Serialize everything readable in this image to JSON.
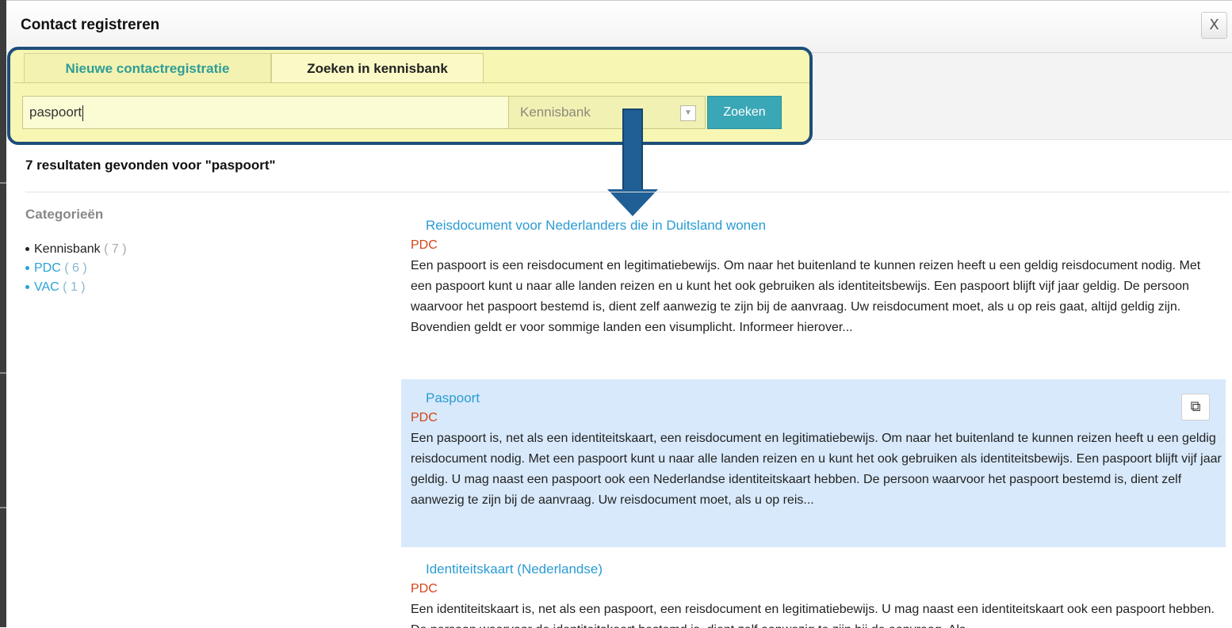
{
  "dialog": {
    "title": "Contact registreren",
    "close_label": "X"
  },
  "tabs": [
    {
      "label": "Nieuwe contactregistratie",
      "active": false
    },
    {
      "label": "Zoeken in kennisbank",
      "active": true
    }
  ],
  "search": {
    "query": "paspoort",
    "source_select": "Kennisbank",
    "button_label": "Zoeken"
  },
  "results_header": "7 resultaten gevonden voor \"paspoort\"",
  "categories": {
    "title": "Categorieën",
    "items": [
      {
        "label": "Kennisbank",
        "count": "( 7 )"
      },
      {
        "label": "PDC",
        "count": "( 6 )"
      },
      {
        "label": "VAC",
        "count": "( 1 )"
      }
    ]
  },
  "results": [
    {
      "title": "Reisdocument voor Nederlanders die in Duitsland wonen",
      "source": "PDC",
      "snippet": "Een paspoort is een reisdocument en legitimatiebewijs. Om naar het buitenland te kunnen reizen heeft u een geldig reisdocument nodig. Met een paspoort kunt u naar alle landen reizen en u kunt het ook gebruiken als identiteitsbewijs. Een paspoort blijft vijf jaar geldig. De persoon waarvoor het paspoort bestemd is, dient zelf aanwezig te zijn bij de aanvraag. Uw reisdocument moet, als u op reis gaat, altijd geldig zijn. Bovendien geldt er voor sommige landen een visumplicht. Informeer hierover..."
    },
    {
      "title": "Paspoort",
      "source": "PDC",
      "snippet": "Een paspoort is, net als een identiteitskaart, een reisdocument en legitimatiebewijs. Om naar het buitenland te kunnen reizen heeft u een geldig reisdocument nodig. Met een paspoort kunt u naar alle landen reizen en u kunt het ook gebruiken als identiteitsbewijs. Een paspoort blijft vijf jaar geldig. U mag naast een paspoort ook een Nederlandse identiteitskaart hebben. De persoon waarvoor het paspoort bestemd is, dient zelf aanwezig te zijn bij de aanvraag. Uw reisdocument moet, als u op reis...",
      "copy_icon": "copy-icon"
    },
    {
      "title": "Identiteitskaart (Nederlandse)",
      "source": "PDC",
      "snippet": "Een identiteitskaart is, net als een paspoort, een reisdocument en legitimatiebewijs. U mag naast een identiteitskaart ook een paspoort hebben. De persoon waarvoor de identiteitskaart bestemd is, dient zelf aanwezig te zijn bij de aanvraag. Als"
    }
  ],
  "colors": {
    "accent_teal": "#3aa7b6",
    "link_blue": "#2a9bd3",
    "source_red": "#d4441a",
    "highlight_yellow": "#f7f6b3",
    "annotation_navy": "#1c4e79",
    "selected_row": "#d8e9fb"
  }
}
